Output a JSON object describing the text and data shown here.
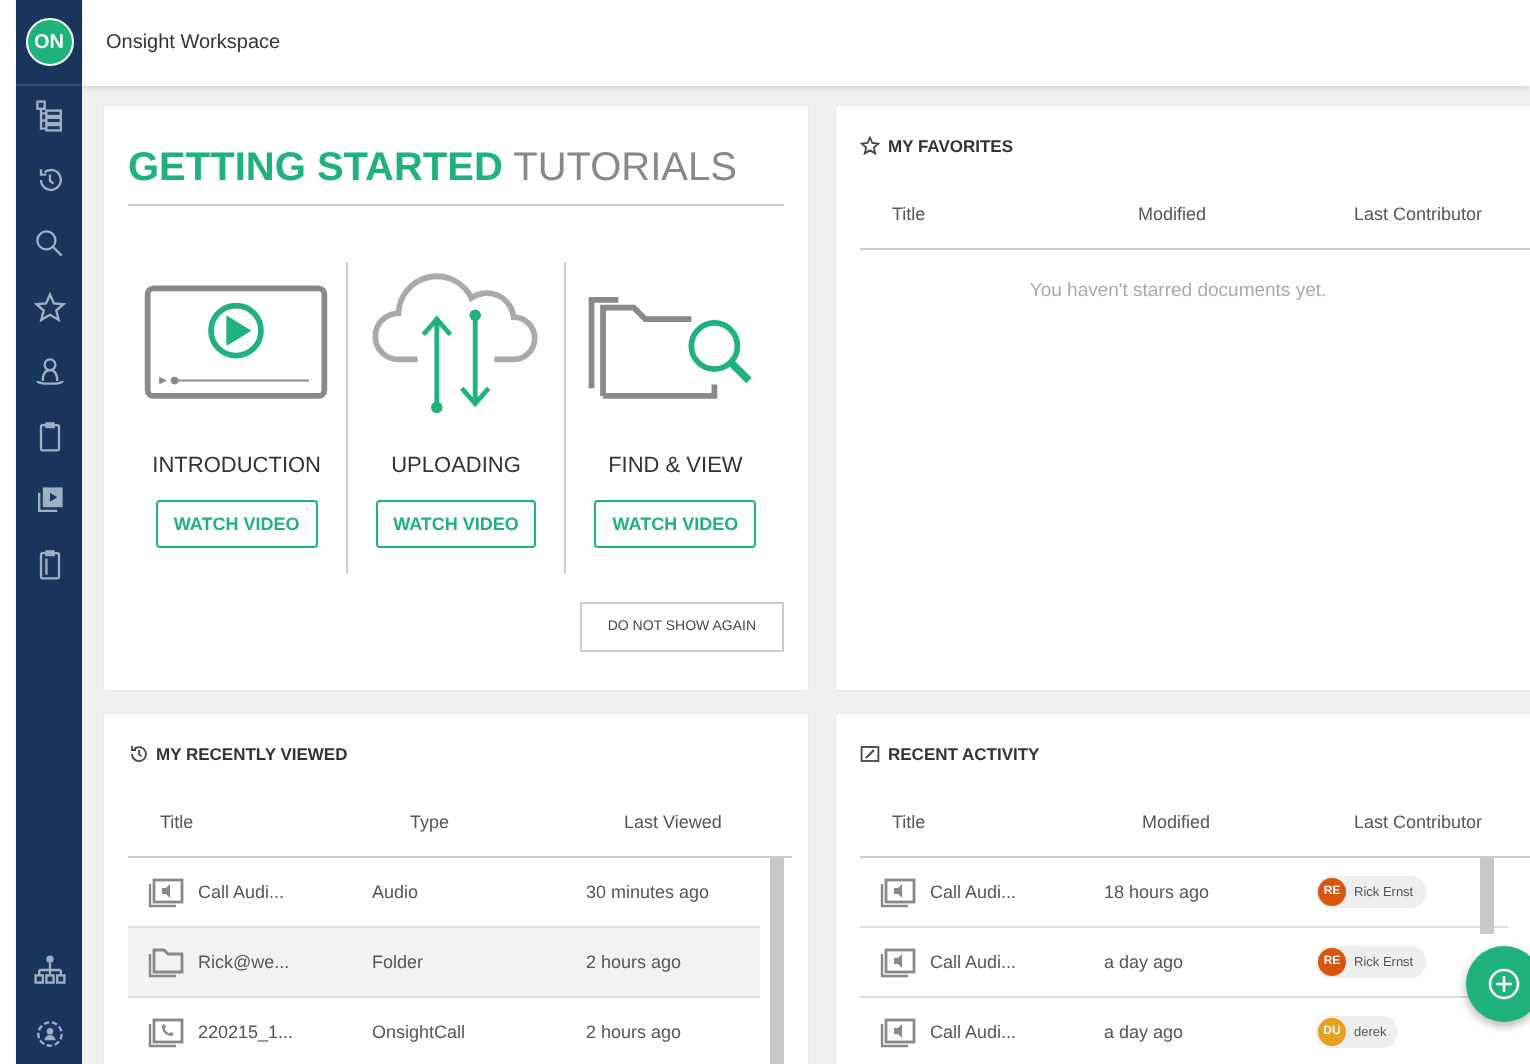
{
  "app": {
    "logo": "ON",
    "title": "Onsight Workspace"
  },
  "tutorials": {
    "title_highlight": "GETTING STARTED",
    "title": "TUTORIALS",
    "dismiss": "DO NOT SHOW AGAIN",
    "items": [
      {
        "kind": "video",
        "label": "INTRODUCTION",
        "button": "WATCH VIDEO"
      },
      {
        "kind": "upload",
        "label": "UPLOADING",
        "button": "WATCH VIDEO"
      },
      {
        "kind": "find",
        "label": "FIND & VIEW",
        "button": "WATCH VIDEO"
      }
    ]
  },
  "favorites": {
    "title": "MY FAVORITES",
    "columns": [
      "Title",
      "Modified",
      "Last Contributor"
    ],
    "empty_message": "You haven't starred documents yet."
  },
  "recently_viewed": {
    "title": "MY RECENTLY VIEWED",
    "columns": [
      "Title",
      "Type",
      "Last Viewed"
    ],
    "rows": [
      {
        "kind": "audio",
        "title": "Call Audi...",
        "type": "Audio",
        "last_viewed": "30 minutes ago",
        "selected": false
      },
      {
        "kind": "folder",
        "title": "Rick@we...",
        "type": "Folder",
        "last_viewed": "2 hours ago",
        "selected": true
      },
      {
        "kind": "call",
        "title": "220215_1...",
        "type": "OnsightCall",
        "last_viewed": "2 hours ago",
        "selected": false
      }
    ]
  },
  "recent_activity": {
    "title": "RECENT ACTIVITY",
    "columns": [
      "Title",
      "Modified",
      "Last Contributor"
    ],
    "rows": [
      {
        "kind": "audio",
        "title": "Call Audi...",
        "modified": "18 hours ago",
        "contributor": {
          "initials": "RE",
          "name": "Rick Ernst",
          "color": "#d9540f"
        }
      },
      {
        "kind": "audio",
        "title": "Call Audi...",
        "modified": "a day ago",
        "contributor": {
          "initials": "RE",
          "name": "Rick Ernst",
          "color": "#d9540f"
        }
      },
      {
        "kind": "audio",
        "title": "Call Audi...",
        "modified": "a day ago",
        "contributor": {
          "initials": "DU",
          "name": "derek",
          "color": "#e8a020"
        }
      }
    ]
  }
}
